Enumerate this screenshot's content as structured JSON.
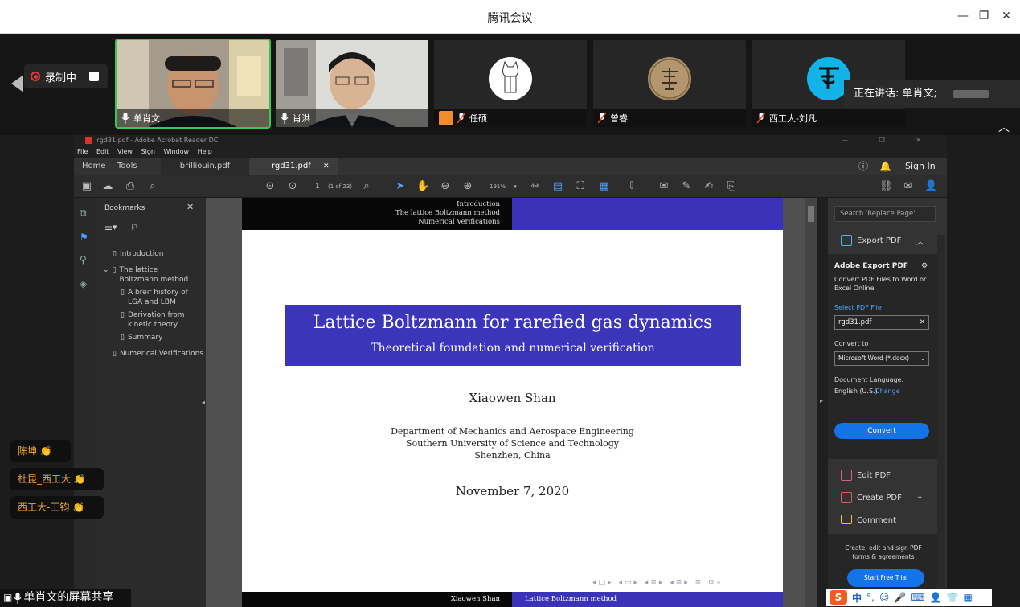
{
  "app": {
    "title": "腾讯会议"
  },
  "recording": {
    "label": "录制中"
  },
  "speaking": {
    "label": "正在讲话: 单肖文;"
  },
  "participants": [
    {
      "name": "单肖文"
    },
    {
      "name": "肖洪"
    },
    {
      "name": "任硕"
    },
    {
      "name": "曾睿"
    },
    {
      "name": "西工大-刘凡"
    }
  ],
  "reactions": [
    {
      "name": "陈坤",
      "emoji": "👏"
    },
    {
      "name": "杜昆_西工大",
      "emoji": "👏"
    },
    {
      "name": "西工大-王钧",
      "emoji": "👏"
    }
  ],
  "share_label": "单肖文的屏幕共享",
  "acrobat": {
    "title": "rgd31.pdf - Adobe Acrobat Reader DC",
    "menu": [
      "File",
      "Edit",
      "View",
      "Sign",
      "Window",
      "Help"
    ],
    "tabs": {
      "home": "Home",
      "tools": "Tools",
      "file1": "brilliouin.pdf",
      "file2": "rgd31.pdf"
    },
    "sign_in": "Sign In",
    "page": "1",
    "page_of": "(1 of 23)",
    "zoom": "191%",
    "bookmarks_title": "Bookmarks",
    "bookmarks": [
      {
        "label": "Introduction"
      },
      {
        "label": "The lattice Boltzmann method"
      },
      {
        "label": "A breif history of LGA and LBM"
      },
      {
        "label": "Derivation from kinetic theory"
      },
      {
        "label": "Summary"
      },
      {
        "label": "Numerical Verifications"
      }
    ],
    "right_panel": {
      "search_placeholder": "Search 'Replace Page'",
      "export_pdf": "Export PDF",
      "adobe_export_pdf": "Adobe Export PDF",
      "convert_desc": "Convert PDF Files to Word or Excel Online",
      "select_pdf": "Select PDF File",
      "file_value": "rgd31.pdf",
      "convert_to": "Convert to",
      "convert_option": "Microsoft Word (*.docx)",
      "doc_language": "Document Language:",
      "language_value": "English (U.S.)",
      "change": "Change",
      "convert_button": "Convert",
      "edit_pdf": "Edit PDF",
      "create_pdf": "Create PDF",
      "comment": "Comment",
      "promo": "Create, edit and sign PDF forms & agreements",
      "trial": "Start Free Trial"
    }
  },
  "slide": {
    "header": [
      "Introduction",
      "The lattice Boltzmann method",
      "Numerical Verifications"
    ],
    "title": "Lattice Boltzmann for rarefied gas dynamics",
    "subtitle": "Theoretical foundation and numerical verification",
    "author": "Xiaowen Shan",
    "affiliation": [
      "Department of Mechanics and Aerospace Engineering",
      "Southern University of Science and Technology",
      "Shenzhen, China"
    ],
    "date": "November 7, 2020",
    "footer_author": "Xiaowen Shan",
    "footer_title": "Lattice Boltzmann method"
  },
  "tray": {
    "ime": "中"
  }
}
